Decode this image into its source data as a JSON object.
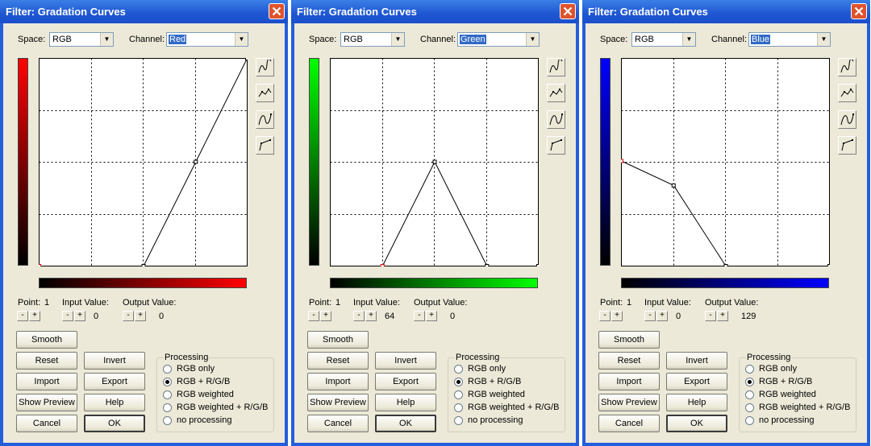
{
  "windows": [
    {
      "id": "red",
      "title": "Filter: Gradation Curves",
      "space_label": "Space:",
      "space_value": "RGB",
      "channel_label": "Channel:",
      "channel_value": "Red",
      "channel_color": "#ff0000",
      "curve_points": [
        [
          0,
          0
        ],
        [
          128,
          0
        ],
        [
          192,
          128
        ],
        [
          255,
          255
        ]
      ],
      "selected_point": 0,
      "point_label": "Point:",
      "point_value": "1",
      "input_label": "Input Value:",
      "input_value": "0",
      "output_label": "Output Value:",
      "output_value": "0"
    },
    {
      "id": "green",
      "title": "Filter: Gradation Curves",
      "space_label": "Space:",
      "space_value": "RGB",
      "channel_label": "Channel:",
      "channel_value": "Green",
      "channel_color": "#00ff00",
      "curve_points": [
        [
          64,
          0
        ],
        [
          128,
          128
        ],
        [
          192,
          0
        ],
        [
          255,
          0
        ]
      ],
      "selected_point": 0,
      "point_label": "Point:",
      "point_value": "1",
      "input_label": "Input Value:",
      "input_value": "64",
      "output_label": "Output Value:",
      "output_value": "0"
    },
    {
      "id": "blue",
      "title": "Filter: Gradation Curves",
      "space_label": "Space:",
      "space_value": "RGB",
      "channel_label": "Channel:",
      "channel_value": "Blue",
      "channel_color": "#0000ff",
      "curve_points": [
        [
          0,
          129
        ],
        [
          64,
          99
        ],
        [
          128,
          0
        ],
        [
          255,
          0
        ]
      ],
      "selected_point": 0,
      "point_label": "Point:",
      "point_value": "1",
      "input_label": "Input Value:",
      "input_value": "0",
      "output_label": "Output Value:",
      "output_value": "129"
    }
  ],
  "common": {
    "minus": "-",
    "plus": "+",
    "buttons": {
      "smooth": "Smooth",
      "reset": "Reset",
      "invert": "Invert",
      "import": "Import",
      "export": "Export",
      "show_preview": "Show Preview",
      "help": "Help",
      "cancel": "Cancel",
      "ok": "OK"
    },
    "processing": {
      "legend": "Processing",
      "options": [
        "RGB only",
        "RGB + R/G/B",
        "RGB weighted",
        "RGB weighted + R/G/B",
        "no processing"
      ],
      "selected": 1
    },
    "tool_icons": [
      "freehand-curve-icon",
      "point-curve-icon",
      "smooth-curve-icon",
      "linear-curve-icon"
    ],
    "colors": {
      "titlebar": "#245edb",
      "face": "#ece9d8",
      "close": "#e0532d"
    }
  }
}
